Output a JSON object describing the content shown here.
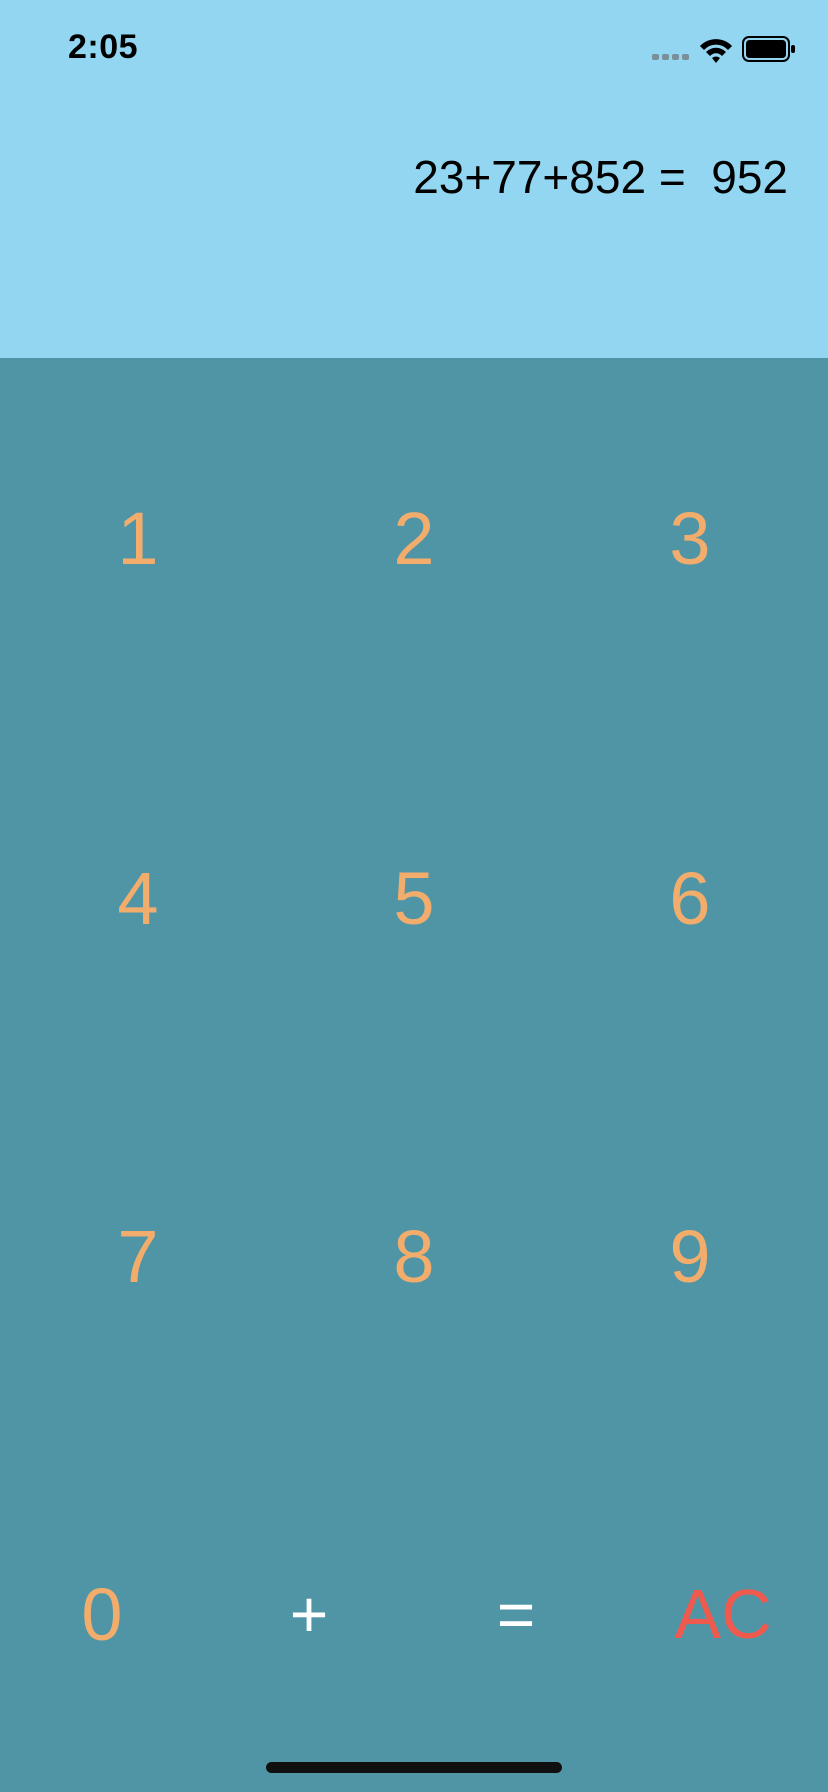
{
  "status_bar": {
    "time": "2:05",
    "icons": [
      "signal-dots-icon",
      "wifi-icon",
      "battery-icon"
    ]
  },
  "display": {
    "expression": "23+77+852 =",
    "result": "952"
  },
  "keypad": {
    "rows": [
      [
        "1",
        "2",
        "3"
      ],
      [
        "4",
        "5",
        "6"
      ],
      [
        "7",
        "8",
        "9"
      ]
    ],
    "bottom_row": {
      "zero": "0",
      "plus": "+",
      "equals": "=",
      "clear": "AC"
    }
  },
  "colors": {
    "display_background": "#92d6f1",
    "keypad_background": "#5095a6",
    "digit_color": "#f2ad6c",
    "operator_color": "#ffffff",
    "clear_color": "#ef5a4e"
  }
}
